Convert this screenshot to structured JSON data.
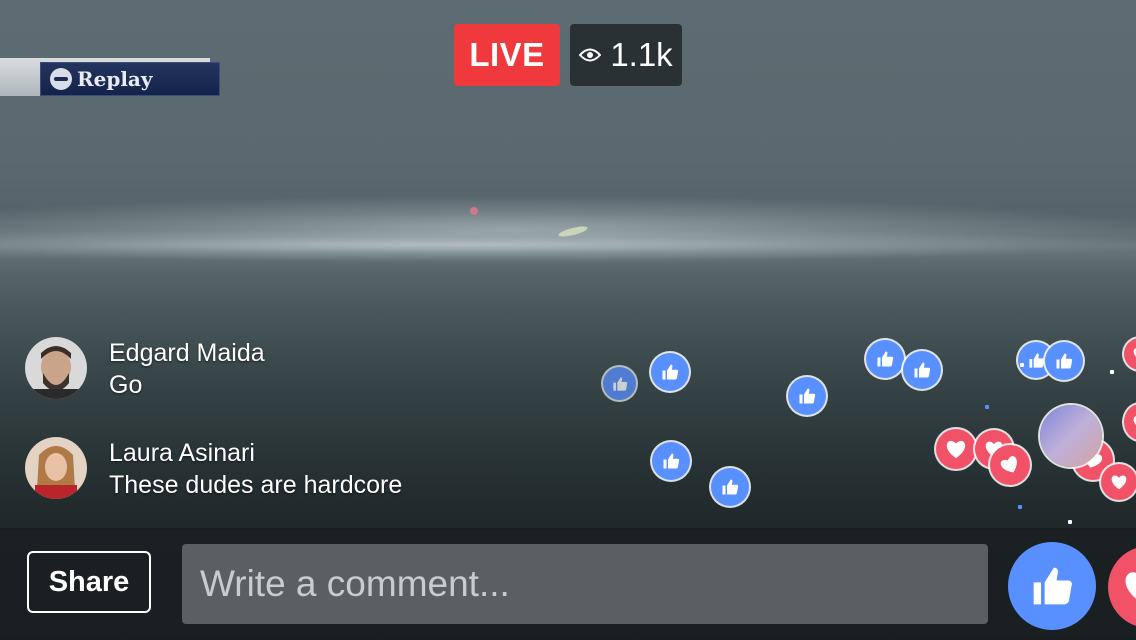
{
  "video": {
    "replay_label": "Replay"
  },
  "live": {
    "badge": "LIVE",
    "viewer_count": "1.1k"
  },
  "comments": [
    {
      "name": "Edgard Maida",
      "text": "Go"
    },
    {
      "name": "Laura Asinari",
      "text": "These dudes are hardcore"
    }
  ],
  "bottom_bar": {
    "share_label": "Share",
    "comment_placeholder": "Write a comment..."
  },
  "reactions": {
    "like_icon": "thumbs-up-icon",
    "love_icon": "heart-icon",
    "colors": {
      "like": "#5890ff",
      "love": "#f25268",
      "live": "#f0393d"
    }
  }
}
